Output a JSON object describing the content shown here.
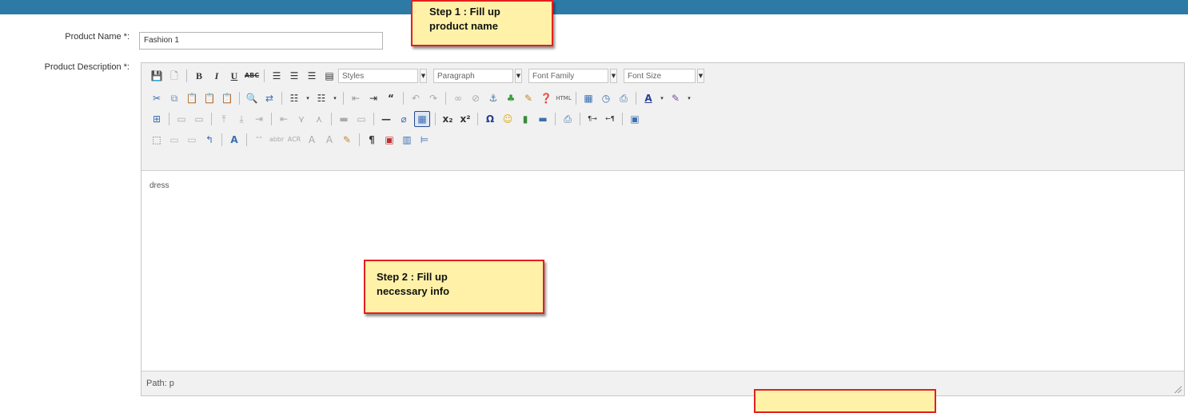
{
  "form": {
    "product_name_label": "Product Name *:",
    "product_name_value": "Fashion 1",
    "product_description_label": "Product Description *:"
  },
  "editor": {
    "dropdowns": {
      "styles": "Styles",
      "paragraph": "Paragraph",
      "font_family": "Font Family",
      "font_size": "Font Size"
    },
    "content_text": "dress",
    "status_path": "Path: p"
  },
  "callouts": {
    "step1_line1": "Step 1  : Fill up",
    "step1_line2": "product name",
    "step2_line1": "Step 2 : Fill up",
    "step2_line2": "necessary info"
  },
  "colors": {
    "header_bar": "#2e7aa6",
    "callout_fill": "#fff2a8",
    "callout_border": "#e41f1f"
  },
  "toolbar_icons": {
    "row1": [
      "save-icon",
      "new-document-icon",
      "bold-icon",
      "italic-icon",
      "underline-icon",
      "strikethrough-icon",
      "align-left-icon",
      "align-center-icon",
      "align-right-icon",
      "align-justify-icon"
    ],
    "row2": [
      "cut-icon",
      "copy-icon",
      "paste-icon",
      "paste-text-icon",
      "paste-word-icon",
      "find-icon",
      "replace-icon",
      "bullet-list-icon",
      "numbered-list-icon",
      "outdent-icon",
      "indent-icon",
      "blockquote-icon",
      "undo-icon",
      "redo-icon",
      "link-icon",
      "unlink-icon",
      "anchor-icon",
      "image-icon",
      "cleanup-icon",
      "help-icon",
      "html-icon",
      "insert-date-icon",
      "insert-time-icon",
      "preview-icon",
      "text-color-icon",
      "highlight-color-icon"
    ],
    "row3": [
      "table-icon",
      "table-row-props-icon",
      "table-cell-props-icon",
      "insert-row-icon",
      "delete-row-icon",
      "insert-column-icon",
      "delete-column-icon",
      "split-cells-icon",
      "merge-cells-icon",
      "horizontal-rule-icon",
      "remove-format-icon",
      "visual-aid-icon",
      "subscript-icon",
      "superscript-icon",
      "charmap-icon",
      "emoticons-icon",
      "media-icon",
      "advanced-hr-icon",
      "print-icon",
      "ltr-icon",
      "rtl-icon",
      "fullscreen-icon"
    ],
    "row4": [
      "insert-layer-icon",
      "move-forward-icon",
      "move-backward-icon",
      "absolute-icon",
      "styleprops-icon",
      "cite-icon",
      "abbreviation-icon",
      "acronym-icon",
      "deletion-icon",
      "insertion-icon",
      "attributes-icon",
      "show-blocks-icon",
      "nonbreaking-icon",
      "pagebreak-icon",
      "template-icon"
    ]
  }
}
